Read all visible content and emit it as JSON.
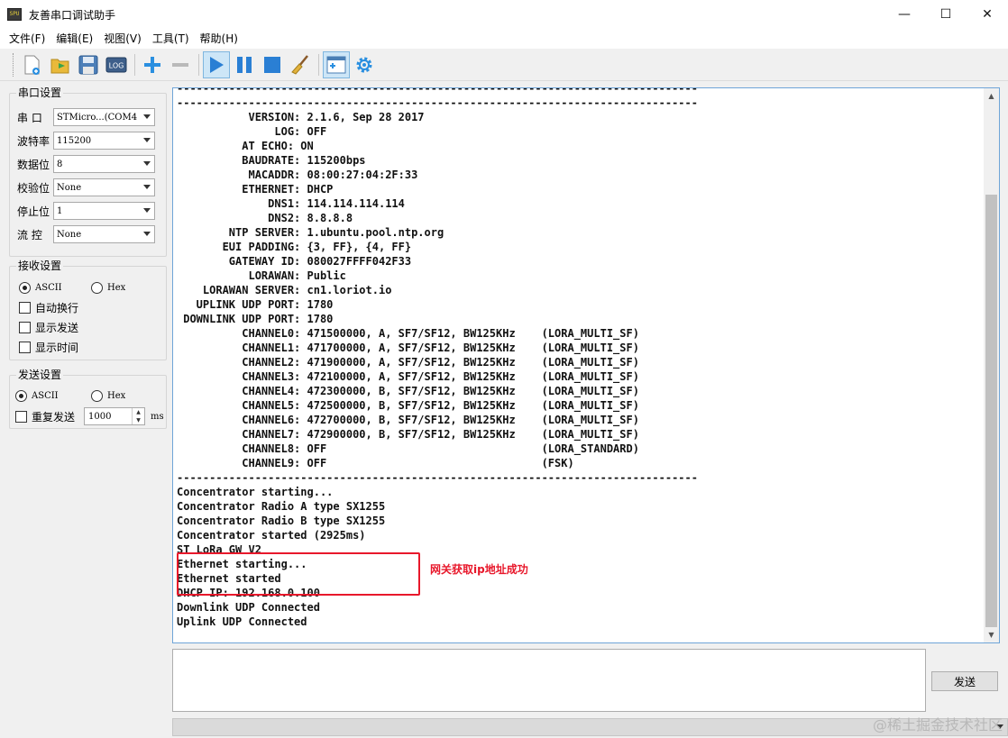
{
  "window": {
    "title": "友善串口调试助手",
    "app_icon": "SPU",
    "minimize": "—",
    "maximize": "☐",
    "close": "✕"
  },
  "menu": [
    "文件(F)",
    "编辑(E)",
    "视图(V)",
    "工具(T)",
    "帮助(H)"
  ],
  "toolbar": {
    "icons": [
      "new-session-icon",
      "open-icon",
      "save-icon",
      "log-icon",
      "add-icon",
      "remove-icon",
      "start-icon",
      "pause-icon",
      "stop-icon",
      "clear-broom-icon",
      "layout-icon",
      "settings-gear-icon"
    ],
    "log_label": "LOG"
  },
  "serial_settings": {
    "title": "串口设置",
    "port": {
      "label": "串 口",
      "value": "STMicro...(COM4"
    },
    "baud": {
      "label": "波特率",
      "value": "115200"
    },
    "databits": {
      "label": "数据位",
      "value": "8"
    },
    "parity": {
      "label": "校验位",
      "value": "None"
    },
    "stopbits": {
      "label": "停止位",
      "value": "1"
    },
    "flow": {
      "label": "流 控",
      "value": "None"
    }
  },
  "receive_settings": {
    "title": "接收设置",
    "ascii": "ASCII",
    "hex": "Hex",
    "auto_wrap": "自动换行",
    "show_send": "显示发送",
    "show_time": "显示时间"
  },
  "send_settings": {
    "title": "发送设置",
    "ascii": "ASCII",
    "hex": "Hex",
    "repeat": "重复发送",
    "interval": "1000",
    "unit": "ms"
  },
  "terminal": {
    "lines": [
      "--------------------------------------------------------------------------------",
      "--------------------------------------------------------------------------------",
      "           VERSION: 2.1.6, Sep 28 2017",
      "               LOG: OFF",
      "          AT ECHO: ON",
      "          BAUDRATE: 115200bps",
      "           MACADDR: 08:00:27:04:2F:33",
      "          ETHERNET: DHCP",
      "              DNS1: 114.114.114.114",
      "              DNS2: 8.8.8.8",
      "        NTP SERVER: 1.ubuntu.pool.ntp.org",
      "       EUI PADDING: {3, FF}, {4, FF}",
      "        GATEWAY ID: 080027FFFF042F33",
      "           LORAWAN: Public",
      "    LORAWAN SERVER: cn1.loriot.io",
      "   UPLINK UDP PORT: 1780",
      " DOWNLINK UDP PORT: 1780",
      "          CHANNEL0: 471500000, A, SF7/SF12, BW125KHz    (LORA_MULTI_SF)",
      "          CHANNEL1: 471700000, A, SF7/SF12, BW125KHz    (LORA_MULTI_SF)",
      "          CHANNEL2: 471900000, A, SF7/SF12, BW125KHz    (LORA_MULTI_SF)",
      "          CHANNEL3: 472100000, A, SF7/SF12, BW125KHz    (LORA_MULTI_SF)",
      "          CHANNEL4: 472300000, B, SF7/SF12, BW125KHz    (LORA_MULTI_SF)",
      "          CHANNEL5: 472500000, B, SF7/SF12, BW125KHz    (LORA_MULTI_SF)",
      "          CHANNEL6: 472700000, B, SF7/SF12, BW125KHz    (LORA_MULTI_SF)",
      "          CHANNEL7: 472900000, B, SF7/SF12, BW125KHz    (LORA_MULTI_SF)",
      "          CHANNEL8: OFF                                 (LORA_STANDARD)",
      "          CHANNEL9: OFF                                 (FSK)",
      "--------------------------------------------------------------------------------",
      "Concentrator starting...",
      "Concentrator Radio A type SX1255",
      "Concentrator Radio B type SX1255",
      "Concentrator started (2925ms)",
      "ST LoRa GW V2",
      "Ethernet starting...",
      "Ethernet started",
      "DHCP IP: 192.168.0.100",
      "Downlink UDP Connected",
      "Uplink UDP Connected"
    ],
    "annotation": "网关获取ip地址成功"
  },
  "send": {
    "button_label": "发送",
    "input_value": ""
  },
  "watermark": "@稀土掘金技术社区",
  "colors": {
    "highlight": "#e8182b",
    "terminal_border": "#6fa5d8"
  }
}
